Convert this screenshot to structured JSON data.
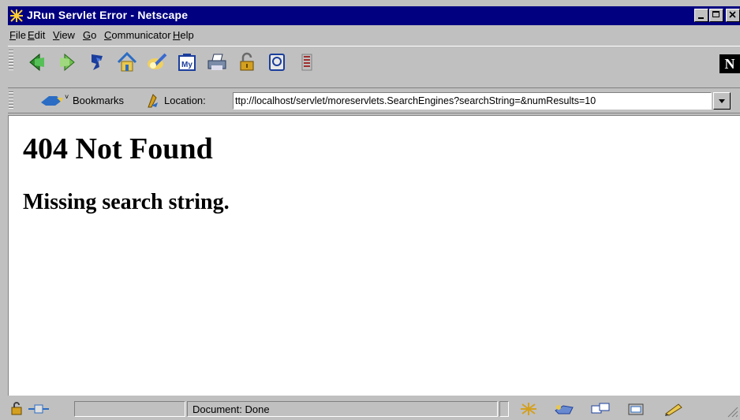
{
  "window": {
    "title": "JRun Servlet Error - Netscape"
  },
  "menu": {
    "items": [
      {
        "accel": "F",
        "rest": "ile"
      },
      {
        "accel": "E",
        "rest": "dit"
      },
      {
        "accel": "V",
        "rest": "iew"
      },
      {
        "accel": "G",
        "rest": "o"
      },
      {
        "accel": "C",
        "rest": "ommunicator"
      },
      {
        "accel": "H",
        "rest": "elp"
      }
    ]
  },
  "toolbar": {
    "buttons": [
      "back-icon",
      "forward-icon",
      "reload-icon",
      "home-icon",
      "search-icon",
      "mynetscape-icon",
      "print-icon",
      "security-icon",
      "shop-icon",
      "stop-icon"
    ],
    "brand": "N"
  },
  "locationbar": {
    "bookmarks_label": "Bookmarks",
    "location_label": "Location:",
    "url": "ttp://localhost/servlet/moreservlets.SearchEngines?searchString=&numResults=10"
  },
  "page": {
    "heading": "404 Not Found",
    "message": "Missing search string."
  },
  "status": {
    "text": "Document: Done"
  },
  "colors": {
    "titlebar": "#000080",
    "chrome": "#c0c0c0",
    "content": "#ffffff"
  }
}
